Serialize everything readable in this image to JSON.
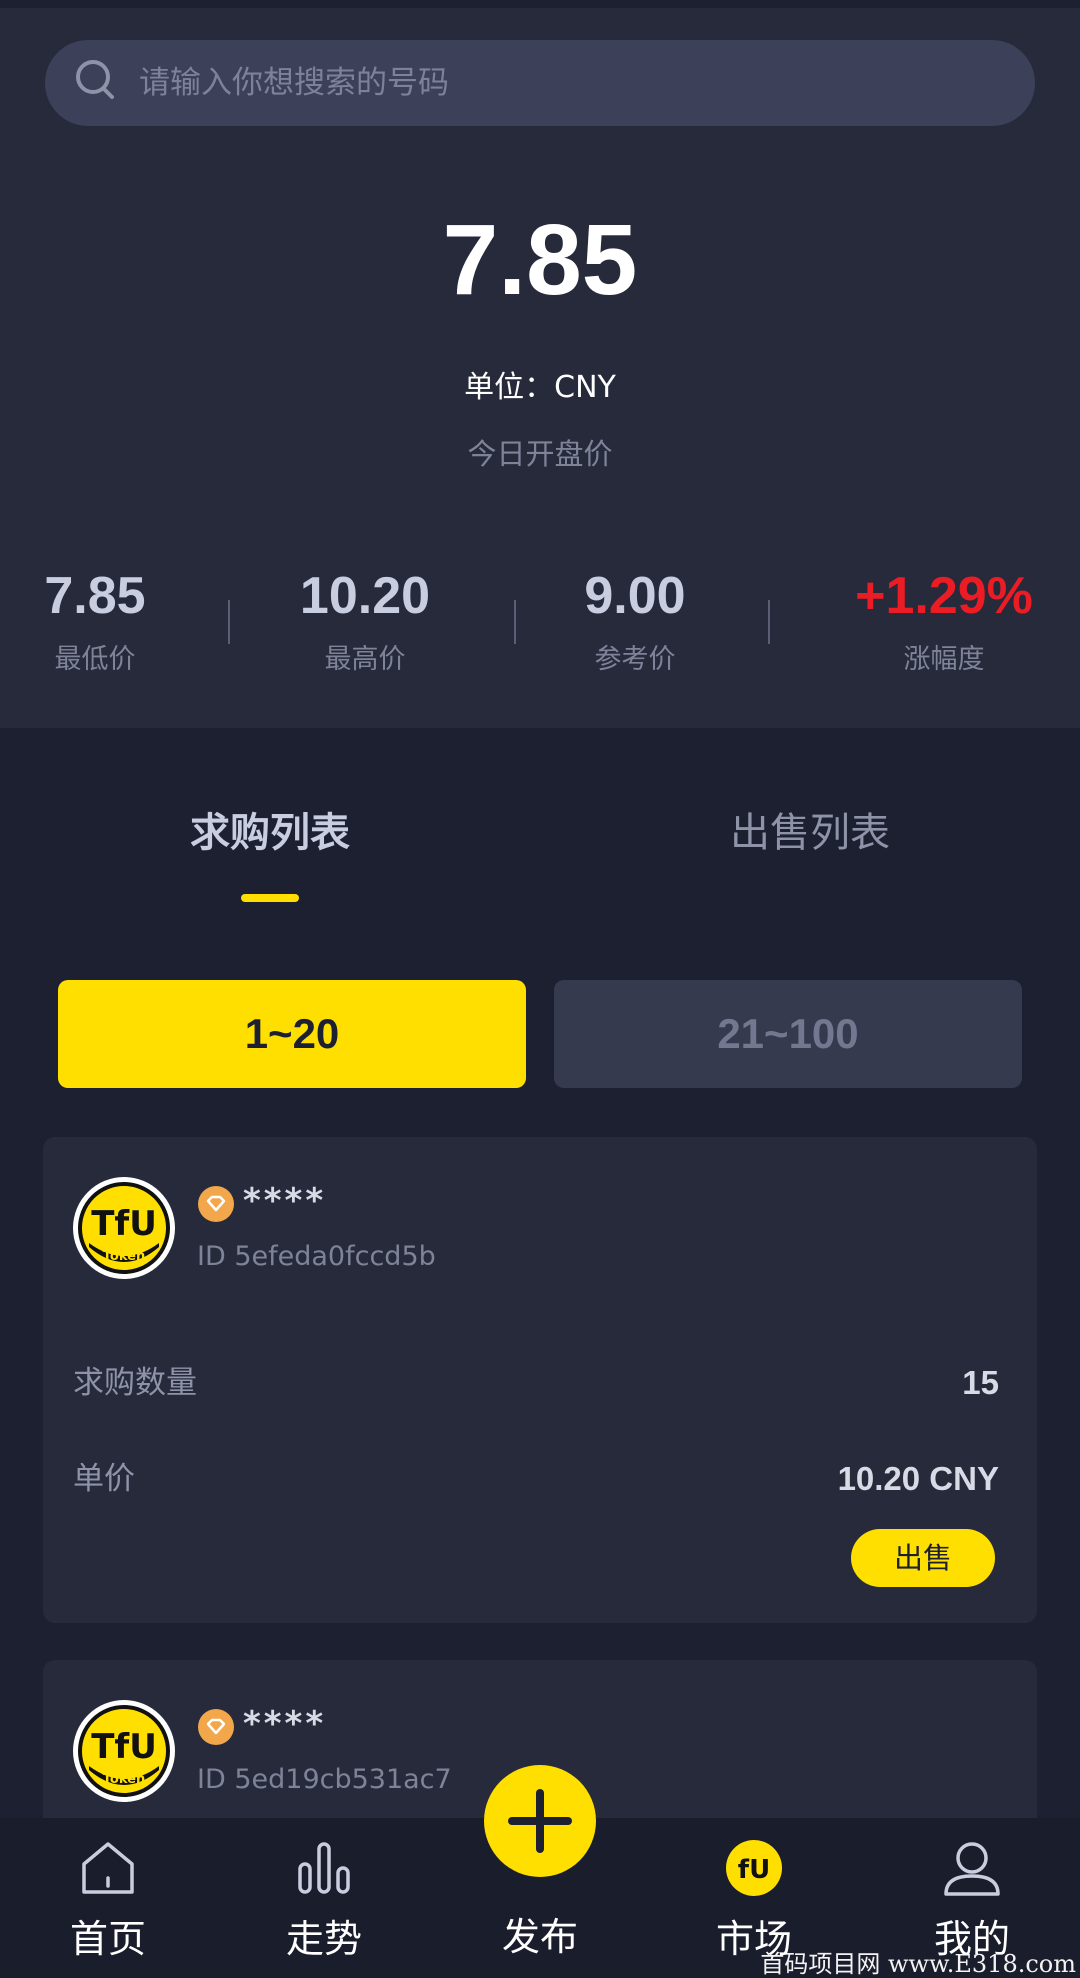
{
  "search": {
    "placeholder": "请输入你想搜索的号码"
  },
  "price": {
    "value": "7.85",
    "unit_line": "单位：CNY",
    "open_label": "今日开盘价"
  },
  "stats": [
    {
      "value": "7.85",
      "label": "最低价"
    },
    {
      "value": "10.20",
      "label": "最高价"
    },
    {
      "value": "9.00",
      "label": "参考价"
    },
    {
      "value": "+1.29%",
      "label": "涨幅度"
    }
  ],
  "tabs": [
    {
      "label": "求购列表",
      "active": true
    },
    {
      "label": "出售列表",
      "active": false
    }
  ],
  "ranges": [
    {
      "label": "1~20",
      "active": true
    },
    {
      "label": "21~100",
      "active": false
    }
  ],
  "cards": [
    {
      "name": "****",
      "id": "ID 5efeda0fccd5b",
      "qty_label": "求购数量",
      "qty_value": "15",
      "price_label": "单价",
      "price_value": "10.20 CNY",
      "action": "出售"
    },
    {
      "name": "****",
      "id": "ID 5ed19cb531ac7"
    }
  ],
  "nav": [
    {
      "label": "首页",
      "icon": "home-icon"
    },
    {
      "label": "走势",
      "icon": "bar-chart-icon"
    },
    {
      "label": "发布",
      "icon": "plus-icon"
    },
    {
      "label": "市场",
      "icon": "token-logo-icon"
    },
    {
      "label": "我的",
      "icon": "user-icon"
    }
  ],
  "avatar_text": {
    "main": "TfU",
    "sub": "Token"
  },
  "watermark": "首码项目网 www.E318.com",
  "colors": {
    "background": "#1d2030",
    "panel": "#262a3b",
    "accent": "#ffdf00",
    "up": "#ec1c24",
    "badge": "#f2a74b"
  }
}
